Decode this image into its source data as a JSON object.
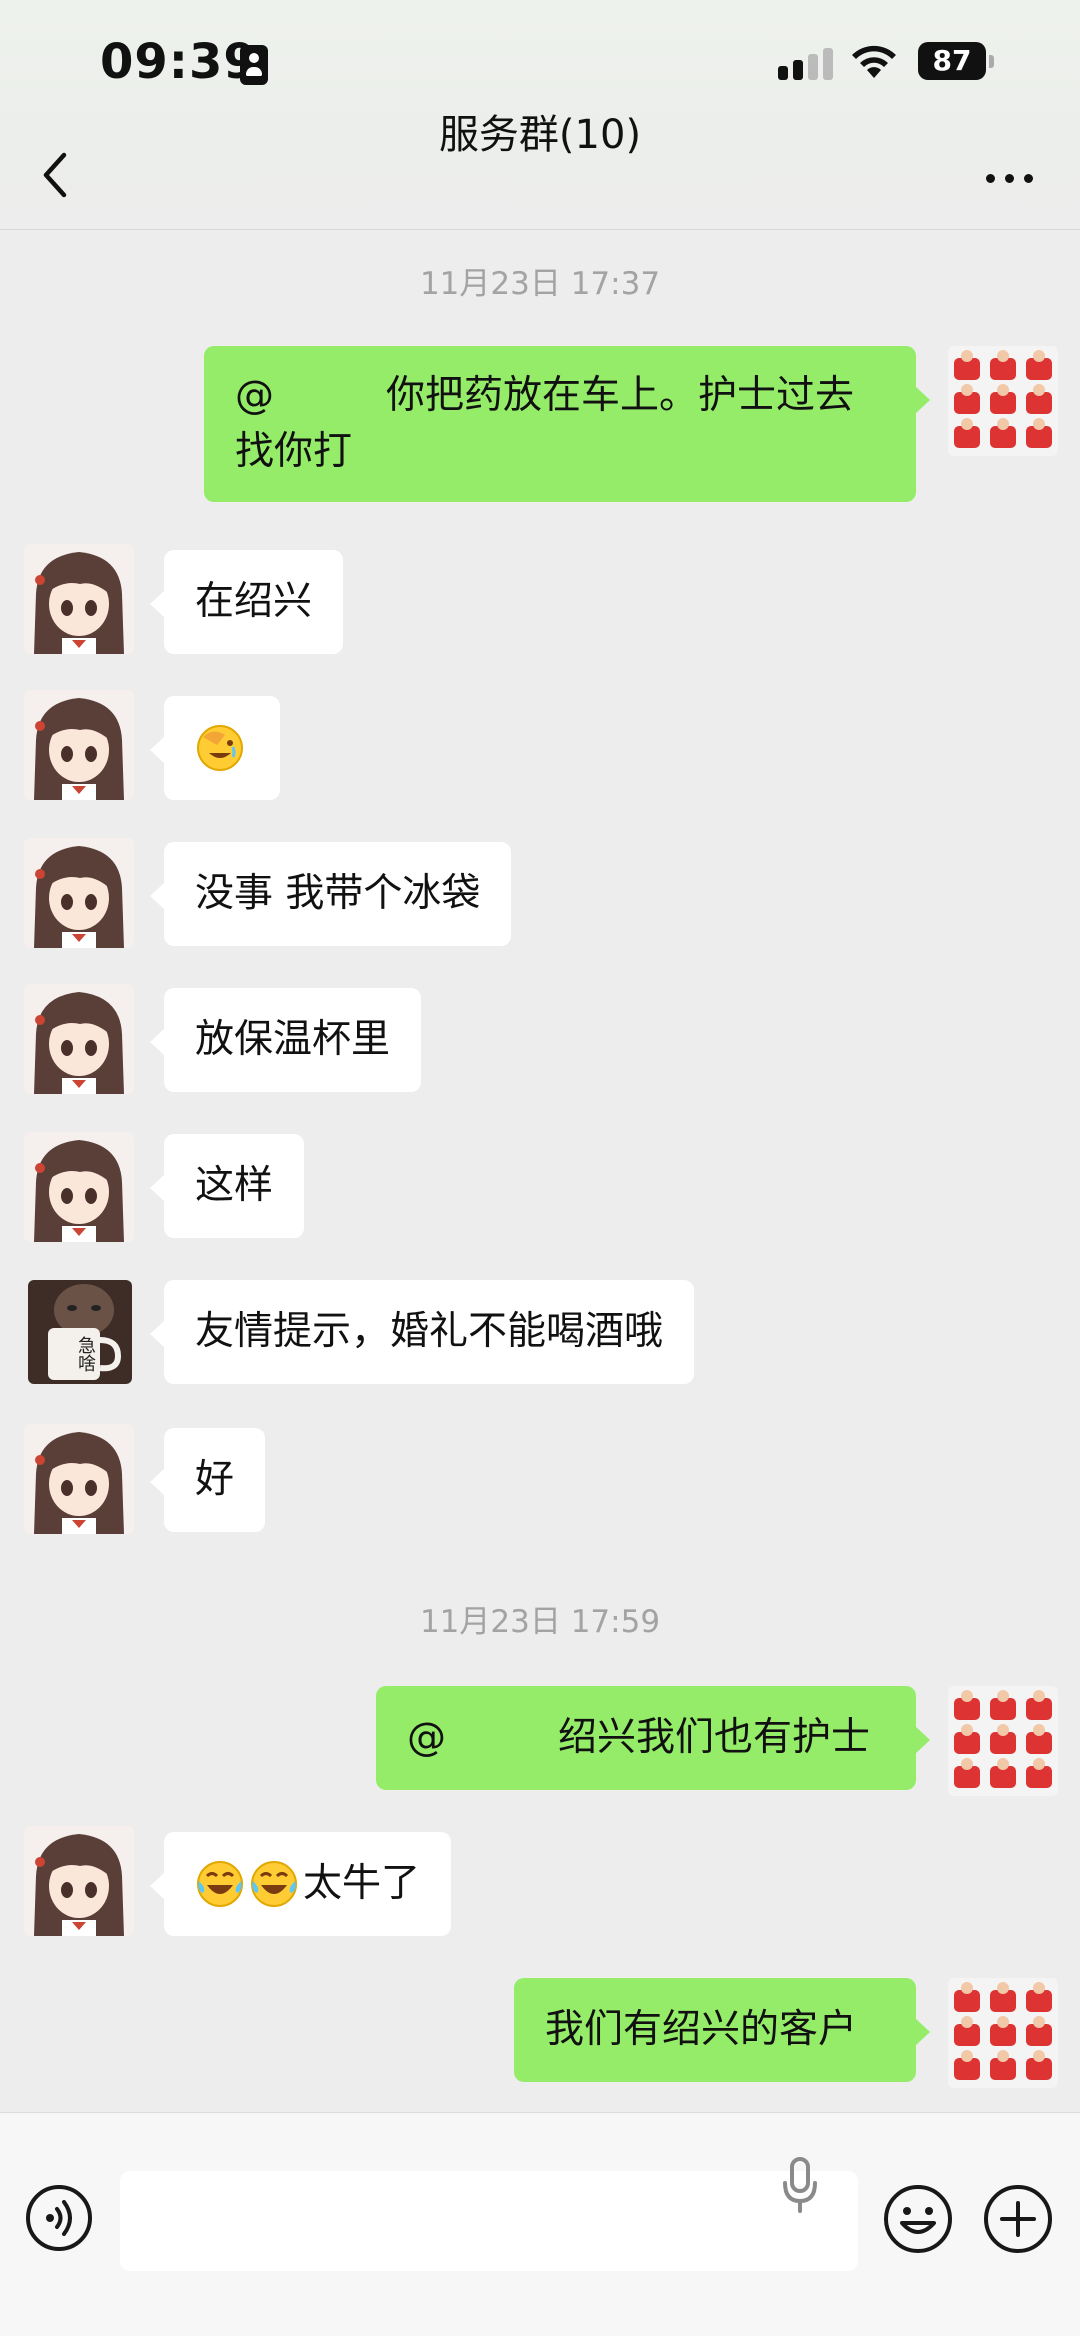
{
  "status_bar": {
    "time": "09:39",
    "battery_percent": "87"
  },
  "nav": {
    "title": "服务群(10)"
  },
  "timestamps": [
    "11月23日 17:37",
    "11月23日 17:59"
  ],
  "messages": [
    {
      "side": "out",
      "sender_avatar": "red-shirt-grid-avatar",
      "mention": "@",
      "text": "你把药放在车上。护士过去找你打"
    },
    {
      "side": "in",
      "sender_avatar": "anime-girl-avatar",
      "text": "在绍兴"
    },
    {
      "side": "in",
      "sender_avatar": "anime-girl-avatar",
      "emoji": [
        "facepalm-laugh-emoji"
      ],
      "text": ""
    },
    {
      "side": "in",
      "sender_avatar": "anime-girl-avatar",
      "text": "没事 我带个冰袋"
    },
    {
      "side": "in",
      "sender_avatar": "anime-girl-avatar",
      "text": "放保温杯里"
    },
    {
      "side": "in",
      "sender_avatar": "anime-girl-avatar",
      "text": "这样"
    },
    {
      "side": "in",
      "sender_avatar": "mug-photo-avatar",
      "text": "友情提示，婚礼不能喝酒哦"
    },
    {
      "side": "in",
      "sender_avatar": "anime-girl-avatar",
      "text": "好"
    },
    {
      "side": "out",
      "sender_avatar": "red-shirt-grid-avatar",
      "mention": "@",
      "text": "绍兴我们也有护士"
    },
    {
      "side": "in",
      "sender_avatar": "anime-girl-avatar",
      "emoji": [
        "tears-of-joy-emoji",
        "tears-of-joy-emoji"
      ],
      "text": "太牛了"
    },
    {
      "side": "out",
      "sender_avatar": "red-shirt-grid-avatar",
      "text": "我们有绍兴的客户"
    }
  ],
  "mug_avatar_text": "急啥",
  "input_bar": {
    "text_value": "",
    "placeholder": ""
  },
  "colors": {
    "outgoing_bubble": "#95ec69",
    "incoming_bubble": "#ffffff",
    "background": "#ededed"
  }
}
